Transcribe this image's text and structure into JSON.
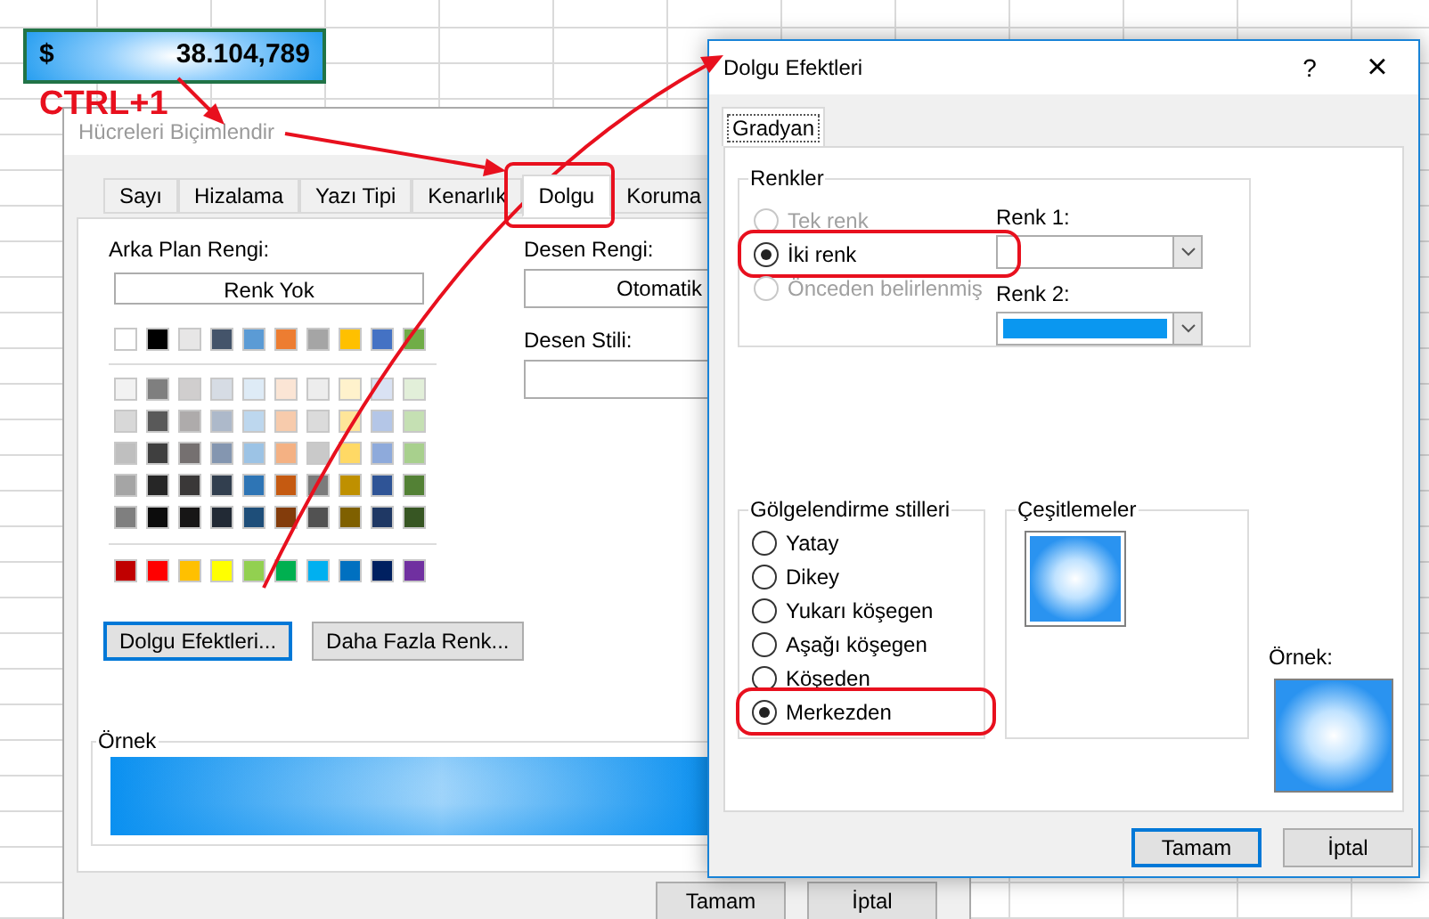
{
  "sheet": {
    "cell": {
      "currency": "$",
      "value": "38.104,789"
    }
  },
  "annotation": {
    "shortcut": "CTRL+1"
  },
  "format_dialog": {
    "title": "Hücreleri Biçimlendir",
    "tabs": [
      {
        "label": "Sayı",
        "selected": false,
        "highlighted": false
      },
      {
        "label": "Hizalama",
        "selected": false,
        "highlighted": false
      },
      {
        "label": "Yazı Tipi",
        "selected": false,
        "highlighted": false
      },
      {
        "label": "Kenarlık",
        "selected": false,
        "highlighted": false
      },
      {
        "label": "Dolgu",
        "selected": true,
        "highlighted": true
      },
      {
        "label": "Koruma",
        "selected": false,
        "highlighted": false
      }
    ],
    "background_color": {
      "label": "Arka Plan Rengi:",
      "no_color": "Renk Yok",
      "theme_colors": [
        {
          "color": "#ffffff"
        },
        {
          "color": "#000000"
        },
        {
          "color": "#e7e6e6"
        },
        {
          "color": "#44546a"
        },
        {
          "color": "#5b9bd5"
        },
        {
          "color": "#ed7d31"
        },
        {
          "color": "#a5a5a5"
        },
        {
          "color": "#ffc000"
        },
        {
          "color": "#4472c4"
        },
        {
          "color": "#70ad47"
        }
      ],
      "shades": [
        [
          {
            "color": "#f2f2f2"
          },
          {
            "color": "#7f7f7f"
          },
          {
            "color": "#d0cece"
          },
          {
            "color": "#d6dce4"
          },
          {
            "color": "#deebf6"
          },
          {
            "color": "#fbe5d5"
          },
          {
            "color": "#ededed"
          },
          {
            "color": "#fff2cc"
          },
          {
            "color": "#d9e2f3"
          },
          {
            "color": "#e2efd9"
          }
        ],
        [
          {
            "color": "#d8d8d8"
          },
          {
            "color": "#595959"
          },
          {
            "color": "#aeabab"
          },
          {
            "color": "#adb9ca"
          },
          {
            "color": "#bdd7ee"
          },
          {
            "color": "#f7cbac"
          },
          {
            "color": "#dbdbdb"
          },
          {
            "color": "#fee599"
          },
          {
            "color": "#b4c6e7"
          },
          {
            "color": "#c5e0b3"
          }
        ],
        [
          {
            "color": "#bfbfbf"
          },
          {
            "color": "#3f3f3f"
          },
          {
            "color": "#757070"
          },
          {
            "color": "#8496b0"
          },
          {
            "color": "#9cc3e5"
          },
          {
            "color": "#f4b183"
          },
          {
            "color": "#c9c9c9"
          },
          {
            "color": "#ffd965"
          },
          {
            "color": "#8eaadb"
          },
          {
            "color": "#a8d08d"
          }
        ],
        [
          {
            "color": "#a5a5a5"
          },
          {
            "color": "#262626"
          },
          {
            "color": "#3a3838"
          },
          {
            "color": "#323f4f"
          },
          {
            "color": "#2e75b5"
          },
          {
            "color": "#c55a11"
          },
          {
            "color": "#7b7b7b"
          },
          {
            "color": "#bf9000"
          },
          {
            "color": "#2f5496"
          },
          {
            "color": "#538135"
          }
        ],
        [
          {
            "color": "#7f7f7f"
          },
          {
            "color": "#0c0c0c"
          },
          {
            "color": "#171616"
          },
          {
            "color": "#222a35"
          },
          {
            "color": "#1e4e79"
          },
          {
            "color": "#833c0b"
          },
          {
            "color": "#525252"
          },
          {
            "color": "#7f6000"
          },
          {
            "color": "#1f3864"
          },
          {
            "color": "#375623"
          }
        ]
      ],
      "standard_colors": [
        {
          "color": "#c00000"
        },
        {
          "color": "#ff0000"
        },
        {
          "color": "#ffc000"
        },
        {
          "color": "#ffff00"
        },
        {
          "color": "#92d050"
        },
        {
          "color": "#00b050"
        },
        {
          "color": "#00b0f0"
        },
        {
          "color": "#0070c0"
        },
        {
          "color": "#002060"
        },
        {
          "color": "#7030a0"
        }
      ]
    },
    "color_buttons": [
      {
        "label": "Dolgu Efektleri...",
        "focused": true
      },
      {
        "label": "Daha Fazla Renk...",
        "focused": false
      }
    ],
    "pattern_color": {
      "label": "Desen Rengi:",
      "value": "Otomatik"
    },
    "pattern_style": {
      "label": "Desen Stili:"
    },
    "sample": {
      "label": "Örnek"
    },
    "buttons": [
      {
        "label": "Tamam"
      },
      {
        "label": "İptal"
      }
    ]
  },
  "fill_effects_dialog": {
    "title": "Dolgu Efektleri",
    "help": "?",
    "close": "×",
    "tabs": [
      {
        "label": "Gradyan",
        "selected": true
      }
    ],
    "colors_group": {
      "label": "Renkler",
      "options": [
        {
          "label": "Tek renk",
          "selected": false,
          "disabled": true,
          "highlighted": false
        },
        {
          "label": "İki renk",
          "selected": true,
          "disabled": false,
          "highlighted": true
        },
        {
          "label": "Önceden belirlenmiş",
          "selected": false,
          "disabled": true,
          "highlighted": false
        }
      ],
      "pickers": [
        {
          "label": "Renk 1:",
          "color": "#ffffff"
        },
        {
          "label": "Renk 2:",
          "color": "#0a97f0"
        }
      ]
    },
    "shading_group": {
      "label": "Gölgelendirme stilleri",
      "options": [
        {
          "label": "Yatay",
          "selected": false,
          "disabled": false,
          "highlighted": false
        },
        {
          "label": "Dikey",
          "selected": false,
          "disabled": false,
          "highlighted": false
        },
        {
          "label": "Yukarı köşegen",
          "selected": false,
          "disabled": false,
          "highlighted": false
        },
        {
          "label": "Aşağı köşegen",
          "selected": false,
          "disabled": false,
          "highlighted": false
        },
        {
          "label": "Köşeden",
          "selected": false,
          "disabled": false,
          "highlighted": false
        },
        {
          "label": "Merkezden",
          "selected": true,
          "disabled": false,
          "highlighted": true
        }
      ]
    },
    "variants_group": {
      "label": "Çeşitlemeler",
      "variants": [
        {
          "selected": true
        }
      ]
    },
    "sample": {
      "label": "Örnek:"
    },
    "buttons": [
      {
        "label": "Tamam",
        "focused": true
      },
      {
        "label": "İptal",
        "focused": false
      }
    ]
  }
}
